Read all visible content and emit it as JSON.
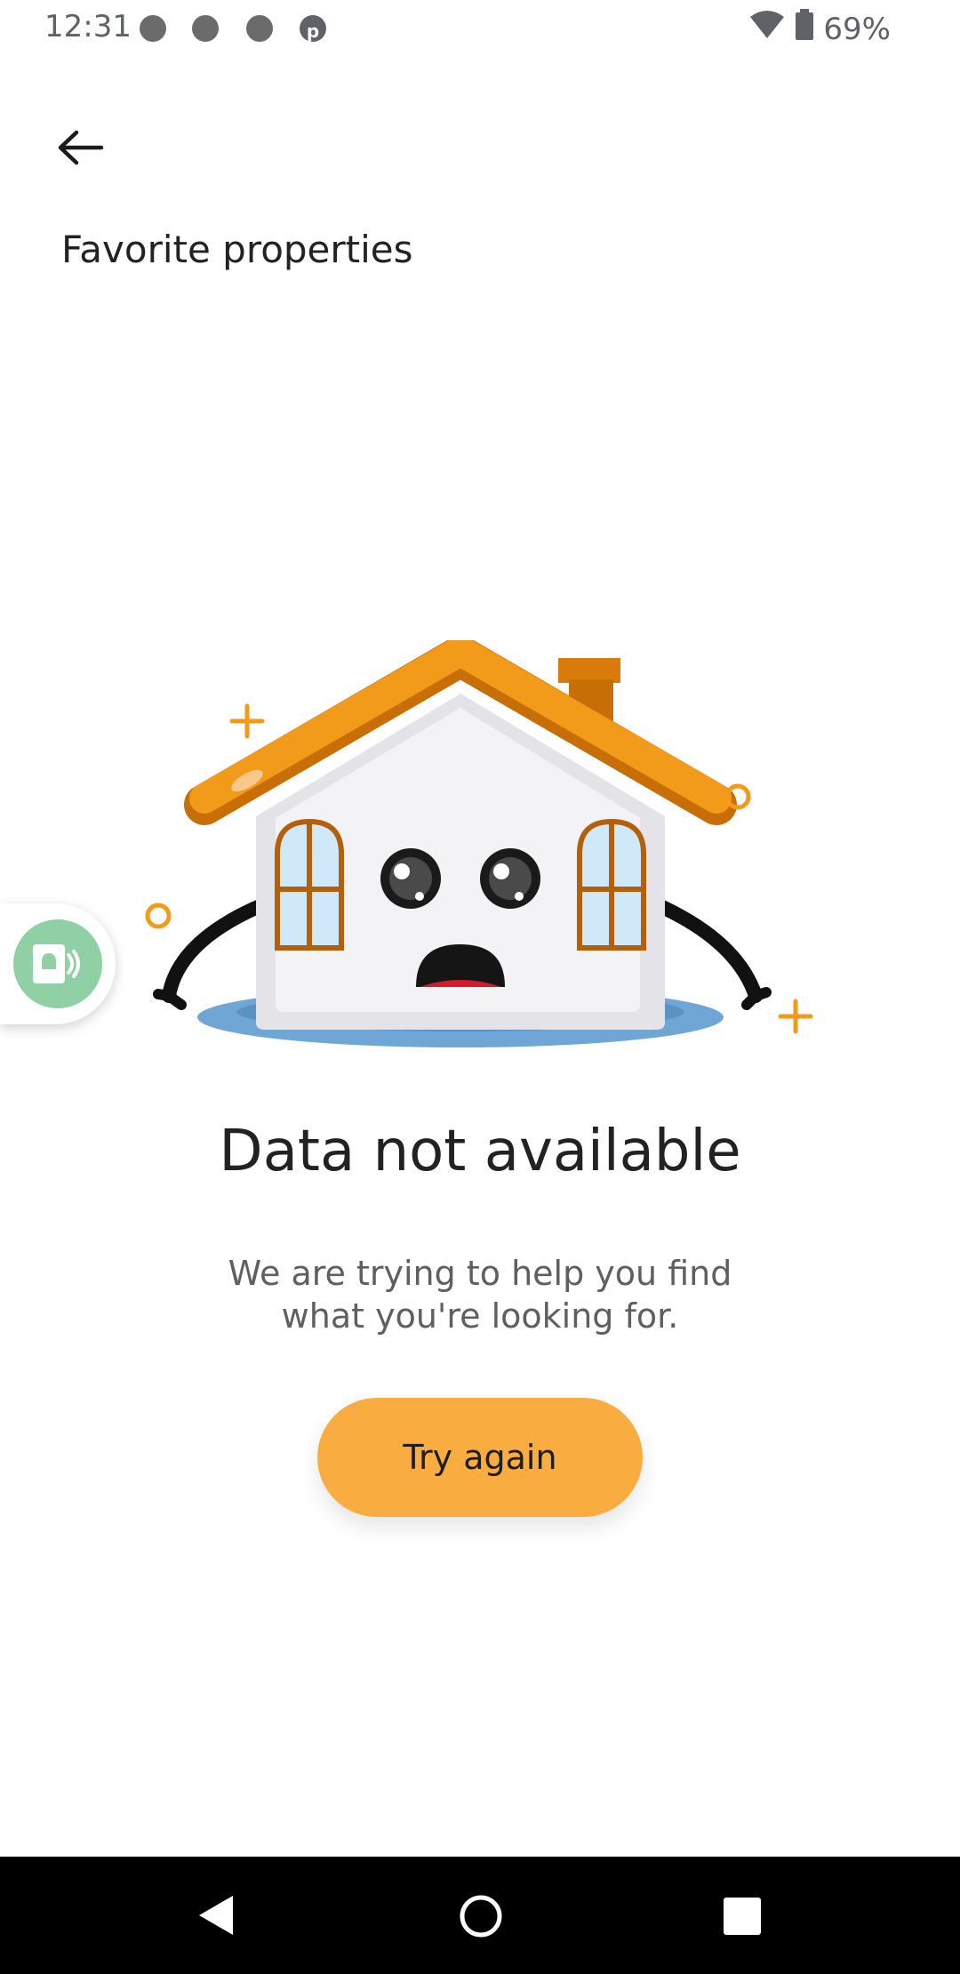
{
  "status_bar": {
    "time": "12:31",
    "battery": "69%",
    "icons": [
      "notification-icon",
      "notification-icon",
      "notification-icon",
      "pinterest-icon",
      "wifi-icon",
      "battery-icon"
    ]
  },
  "header": {
    "title": "Favorite properties",
    "back_icon": "arrow-left-icon"
  },
  "empty_state": {
    "title": "Data not available",
    "message": "We are trying to help you find what you're looking for.",
    "button_label": "Try again",
    "illustration": "sad-house-illustration"
  },
  "floating_widget": {
    "icon": "app-bubble-icon"
  },
  "colors": {
    "accent": "#f9ad40",
    "roof": "#f0900d",
    "puddle": "#6fa6d6",
    "widget": "#8fd1a4"
  },
  "nav_bar": {
    "icons": [
      "back-icon",
      "home-icon",
      "recents-icon"
    ]
  }
}
